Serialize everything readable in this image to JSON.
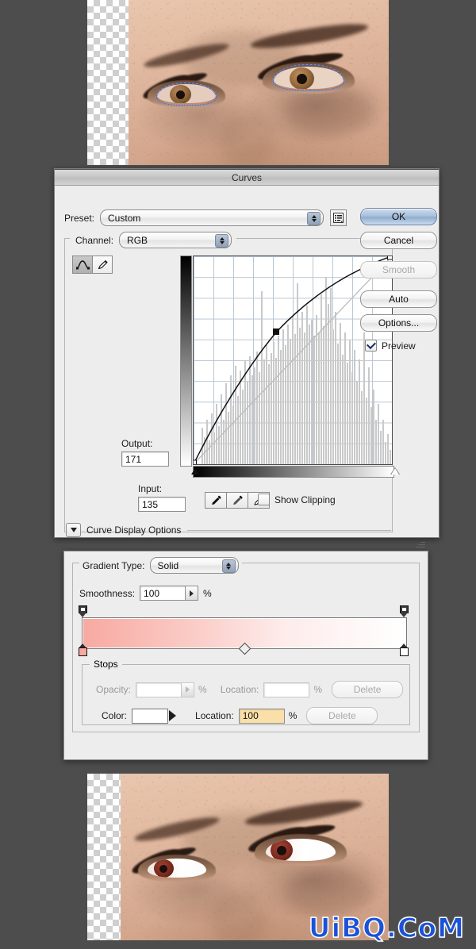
{
  "curves_dialog": {
    "title": "Curves",
    "preset_label": "Preset:",
    "preset_value": "Custom",
    "preset_menu_icon": "preset-options-menu-icon",
    "channel_label": "Channel:",
    "channel_value": "RGB",
    "tools": {
      "curve_tool_icon": "curve-tool-icon",
      "pencil_tool_icon": "pencil-tool-icon"
    },
    "output_label": "Output:",
    "output_value": "171",
    "input_label": "Input:",
    "input_value": "135",
    "eyedroppers": [
      "black-point-eyedropper-icon",
      "gray-point-eyedropper-icon",
      "white-point-eyedropper-icon"
    ],
    "show_clipping_label": "Show Clipping",
    "show_clipping_checked": false,
    "curve_display_options_label": "Curve Display Options",
    "curve_display_expanded": false,
    "buttons": {
      "ok": "OK",
      "cancel": "Cancel",
      "smooth": "Smooth",
      "auto": "Auto",
      "options": "Options..."
    },
    "preview_label": "Preview",
    "preview_checked": true
  },
  "chart_data": {
    "type": "line",
    "title": "Curves",
    "xlabel": "Input",
    "ylabel": "Output",
    "xlim": [
      0,
      255
    ],
    "ylim": [
      0,
      255
    ],
    "grid": true,
    "grid_divisions": 10,
    "series": [
      {
        "name": "baseline-diagonal",
        "x": [
          0,
          255
        ],
        "y": [
          0,
          255
        ]
      },
      {
        "name": "tone-curve",
        "x": [
          0,
          32,
          64,
          96,
          135,
          160,
          192,
          224,
          255
        ],
        "y": [
          0,
          52,
          96,
          134,
          171,
          192,
          215,
          236,
          255
        ]
      }
    ],
    "control_points": [
      {
        "input": 0,
        "output": 0
      },
      {
        "input": 135,
        "output": 171,
        "selected": true
      },
      {
        "input": 255,
        "output": 255
      }
    ],
    "histogram_note": "RGB composite histogram shown behind curve"
  },
  "gradient_dialog": {
    "gradient_type_label": "Gradient Type:",
    "gradient_type_value": "Solid",
    "smoothness_label": "Smoothness:",
    "smoothness_value": "100",
    "percent_symbol": "%",
    "gradient_preview": {
      "start_color": "#f7a9a1",
      "end_color": "#ffffff",
      "midpoint_location": 50
    },
    "stops_group_label": "Stops",
    "opacity_label": "Opacity:",
    "opacity_value": "",
    "opacity_location_label": "Location:",
    "opacity_location_value": "",
    "opacity_delete_label": "Delete",
    "color_label": "Color:",
    "color_value": "#ffffff",
    "color_location_label": "Location:",
    "color_location_value": "100",
    "color_delete_label": "Delete",
    "resize_grip_icon": "resize-grip-icon"
  },
  "photos": {
    "top": {
      "name": "before-eyes-with-selection-paths",
      "description": "Close-up of eyes with path selections on the whites of the eyes"
    },
    "bottom": {
      "name": "after-eyes-brightened",
      "description": "Close-up of eyes after curves and gradient adjustments"
    }
  },
  "watermark": {
    "text": "UiBQ.CoM",
    "color": "#1a52d8"
  }
}
